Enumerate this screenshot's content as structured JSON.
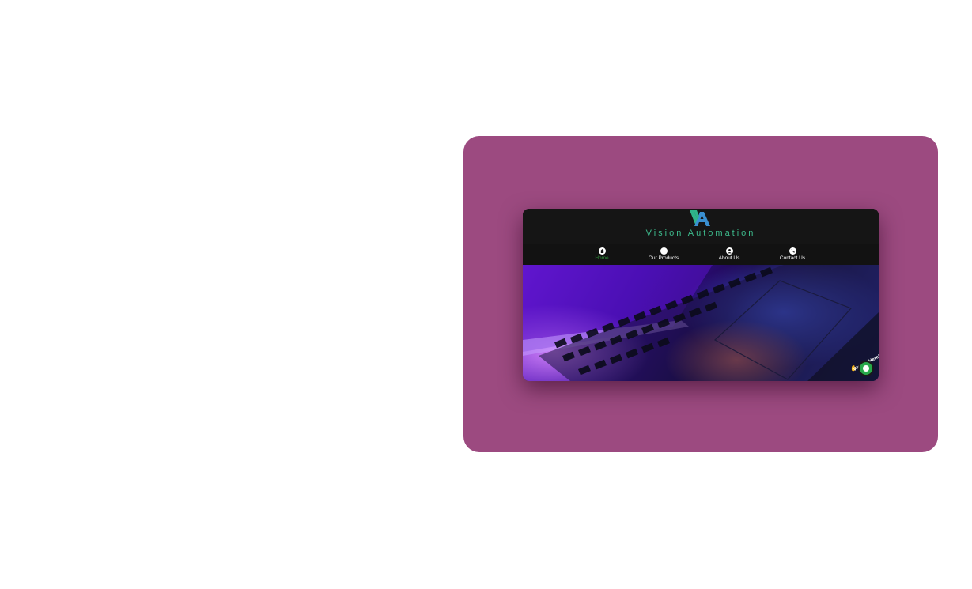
{
  "brand": {
    "name": "Vision Automation",
    "logo_icon": "va-logo-icon",
    "accent_color": "#3dba8c"
  },
  "nav": {
    "items": [
      {
        "label": "Home",
        "icon": "home-icon",
        "active": true
      },
      {
        "label": "Our Products",
        "icon": "products-icon",
        "active": false
      },
      {
        "label": "About Us",
        "icon": "user-icon",
        "active": false
      },
      {
        "label": "Contact Us",
        "icon": "phone-icon",
        "active": false
      }
    ],
    "active_color": "#2f8f3a"
  },
  "hero": {
    "image": "laptop-keyboard-purple-light"
  },
  "chat": {
    "text": "We Are Here!",
    "icon": "chat-bubble-icon",
    "color": "#27a84a"
  },
  "card": {
    "background": "#9c4a80"
  }
}
